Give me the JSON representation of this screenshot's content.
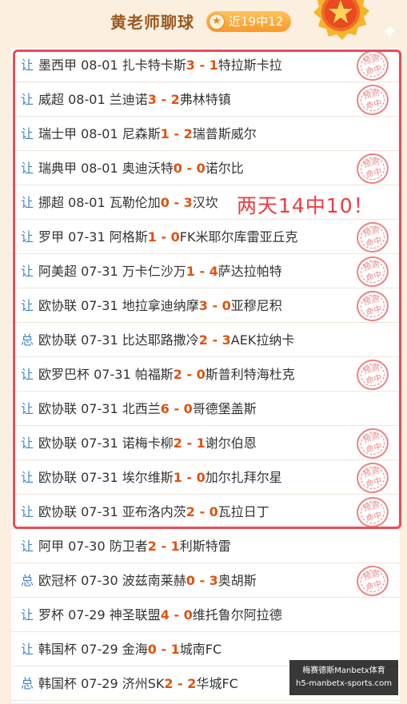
{
  "header": {
    "title": "黄老师聊球",
    "badge_text": "近19中12",
    "badge_icon": "star-icon",
    "medal_icon": "medal-star-icon"
  },
  "annotation": "两天14中10！",
  "stamp_text_top": "预测",
  "stamp_text_bottom": "命中",
  "watermark": {
    "line1": "梅赛德斯Manbetx体育",
    "line2": "h5-manbetx-sports.com"
  },
  "rows": [
    {
      "tag": "让",
      "league": "墨西甲",
      "date": "08-01",
      "home": "扎卡特卡斯",
      "hs": "3",
      "sep": " - ",
      "as": "1",
      "away": "特拉斯卡拉",
      "hit": true
    },
    {
      "tag": "让",
      "league": "威超",
      "date": "08-01",
      "home": "兰迪诺",
      "hs": "3",
      "sep": " - ",
      "as": "2",
      "away": "弗林特镇",
      "hit": true
    },
    {
      "tag": "让",
      "league": "瑞士甲",
      "date": "08-01",
      "home": "尼森斯",
      "hs": "1",
      "sep": " - ",
      "as": "2",
      "away": "瑞普斯威尔",
      "hit": false
    },
    {
      "tag": "让",
      "league": "瑞典甲",
      "date": "08-01",
      "home": "奥迪沃特",
      "hs": "0",
      "sep": " - ",
      "as": "0",
      "away": "诺尔比",
      "hit": true
    },
    {
      "tag": "让",
      "league": "挪超",
      "date": "08-01",
      "home": "瓦勒伦加",
      "hs": "0",
      "sep": " - ",
      "as": "3",
      "away": "汉坎",
      "hit": false
    },
    {
      "tag": "让",
      "league": "罗甲",
      "date": "07-31",
      "home": "阿格斯",
      "hs": "1",
      "sep": " - ",
      "as": "0",
      "away": "FK米耶尔库雷亚丘克",
      "hit": true
    },
    {
      "tag": "让",
      "league": "阿美超",
      "date": "07-31",
      "home": "万卡仁沙万",
      "hs": "1",
      "sep": " - ",
      "as": "4",
      "away": "萨达拉帕特",
      "hit": true
    },
    {
      "tag": "让",
      "league": "欧协联",
      "date": "07-31",
      "home": "地拉拿迪纳摩",
      "hs": "3",
      "sep": " - ",
      "as": "0",
      "away": "亚穆尼积",
      "hit": true
    },
    {
      "tag": "总",
      "league": "欧协联",
      "date": "07-31",
      "home": "比达耶路撒冷",
      "hs": "2",
      "sep": " - ",
      "as": "3",
      "away": "AEK拉纳卡",
      "hit": false
    },
    {
      "tag": "让",
      "league": "欧罗巴杯",
      "date": "07-31",
      "home": "帕福斯",
      "hs": "2",
      "sep": " - ",
      "as": "0",
      "away": "斯普利特海杜克",
      "hit": true
    },
    {
      "tag": "让",
      "league": "欧协联",
      "date": "07-31",
      "home": "北西兰",
      "hs": "6",
      "sep": " - ",
      "as": "0",
      "away": "哥德堡盖斯",
      "hit": false
    },
    {
      "tag": "让",
      "league": "欧协联",
      "date": "07-31",
      "home": "诺梅卡柳",
      "hs": "2",
      "sep": " - ",
      "as": "1",
      "away": "谢尔伯恩",
      "hit": true
    },
    {
      "tag": "让",
      "league": "欧协联",
      "date": "07-31",
      "home": "埃尔维斯",
      "hs": "1",
      "sep": " - ",
      "as": "0",
      "away": "加尔扎拜尔星",
      "hit": true
    },
    {
      "tag": "让",
      "league": "欧协联",
      "date": "07-31",
      "home": "亚布洛内茨",
      "hs": "2",
      "sep": " - ",
      "as": "0",
      "away": "瓦拉日丁",
      "hit": true
    },
    {
      "tag": "让",
      "league": "阿甲",
      "date": "07-30",
      "home": "防卫者",
      "hs": "2",
      "sep": " - ",
      "as": "1",
      "away": "利斯特雷",
      "hit": false
    },
    {
      "tag": "总",
      "league": "欧冠杯",
      "date": "07-30",
      "home": "波兹南莱赫",
      "hs": "0",
      "sep": " - ",
      "as": "3",
      "away": "奥胡斯",
      "hit": true
    },
    {
      "tag": "让",
      "league": "罗杯",
      "date": "07-29",
      "home": "神圣联盟",
      "hs": "4",
      "sep": " - ",
      "as": "0",
      "away": "维托鲁尔阿拉德",
      "hit": false
    },
    {
      "tag": "让",
      "league": "韩国杯",
      "date": "07-29",
      "home": "金海",
      "hs": "0",
      "sep": " - ",
      "as": "1",
      "away": "城南FC",
      "hit": false
    },
    {
      "tag": "总",
      "league": "韩国杯",
      "date": "07-29",
      "home": "济州SK",
      "hs": "2",
      "sep": " - ",
      "as": "2",
      "away": "华城FC",
      "hit": false
    }
  ]
}
